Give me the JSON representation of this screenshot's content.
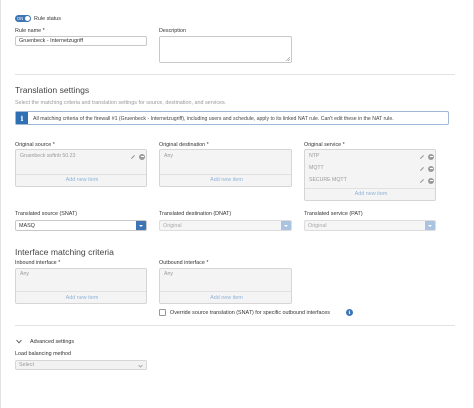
{
  "rule_status": {
    "toggle_label": "ON",
    "label": "Rule status"
  },
  "rule_name": {
    "label": "Rule name *",
    "value": "Gruenbeck - Internetzugriff"
  },
  "description": {
    "label": "Description",
    "value": ""
  },
  "translation": {
    "title": "Translation settings",
    "subtitle": "Select the matching criteria and translation settings for source, destination, and services.",
    "info": "All matching criteria of the firewall #1 (Gruenbeck - Internetzugriff), including users and schedule, apply to its linked NAT rule. Can't edit these in the NAT rule."
  },
  "original_source": {
    "label": "Original source *",
    "items": [
      "Gruenbeck softnb 50.23"
    ],
    "add": "Add new item"
  },
  "original_destination": {
    "label": "Original destination *",
    "placeholder": "Any",
    "add": "Add new item"
  },
  "original_service": {
    "label": "Original service *",
    "items": [
      "NTP",
      "MQTT",
      "SECURE MQTT"
    ],
    "add": "Add new item"
  },
  "translated_source": {
    "label": "Translated source (SNAT)",
    "value": "MASQ"
  },
  "translated_destination": {
    "label": "Translated destination (DNAT)",
    "value": "Original"
  },
  "translated_service": {
    "label": "Translated service (PAT)",
    "value": "Original"
  },
  "interface": {
    "title": "Interface matching criteria",
    "inbound": {
      "label": "Inbound interface *",
      "placeholder": "Any",
      "add": "Add new item"
    },
    "outbound": {
      "label": "Outbound interface *",
      "placeholder": "Any",
      "add": "Add new item"
    },
    "override_label": "Override source translation (SNAT) for specific outbound interfaces"
  },
  "advanced": {
    "label": "Advanced settings"
  },
  "load_balancing": {
    "label": "Load balancing method",
    "placeholder": "Select"
  },
  "colors": {
    "accent": "#3e75b5",
    "link": "#8fb3d9",
    "info_blue": "#2f6fb3"
  }
}
